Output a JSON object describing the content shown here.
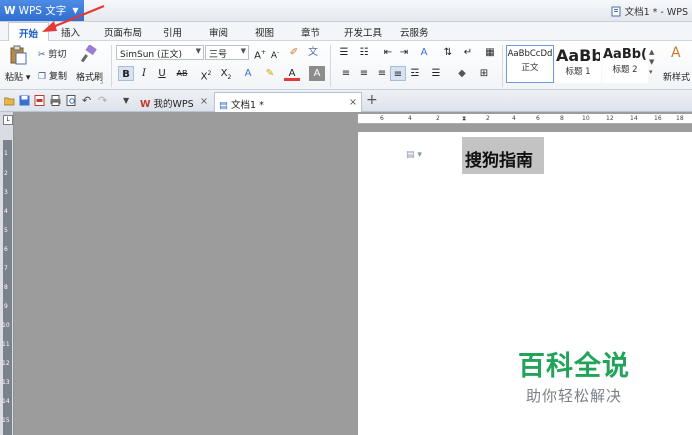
{
  "titlebar": {
    "app_name": "WPS 文字",
    "doc_title": "文档1 * - WPS"
  },
  "menu": {
    "tabs": [
      "开始",
      "插入",
      "页面布局",
      "引用",
      "审阅",
      "视图",
      "章节",
      "开发工具",
      "云服务"
    ],
    "active_index": 0
  },
  "ribbon": {
    "paste_label": "粘贴",
    "cut_label": "剪切",
    "copy_label": "复制",
    "format_painter_label": "格式刷",
    "font_name": "SimSun (正文)",
    "font_size": "三号",
    "styles": [
      {
        "sample": "AaBbCcDd",
        "label": "正文"
      },
      {
        "sample": "AaBb",
        "label": "标题 1"
      },
      {
        "sample": "AaBb(",
        "label": "标题 2"
      }
    ],
    "new_style_label": "新样式"
  },
  "doc_tabs": [
    {
      "label": "我的WPS",
      "active": false
    },
    {
      "label": "文档1 *",
      "active": true
    }
  ],
  "ruler": {
    "vertical_numbers": [
      "1",
      "2",
      "3",
      "4",
      "5",
      "6",
      "7",
      "8",
      "9",
      "10",
      "11",
      "12",
      "13",
      "14",
      "15"
    ],
    "horizontal_numbers": [
      "6",
      "4",
      "2",
      "2",
      "4",
      "6",
      "8",
      "10",
      "12",
      "14",
      "16",
      "18"
    ]
  },
  "document": {
    "heading": "搜狗指南"
  },
  "watermark": {
    "main": "百科全说",
    "sub": "助你轻松解决"
  },
  "colors": {
    "accent": "#2e6ed1",
    "watermark_green": "#22a35a",
    "arrow_red": "#e53935"
  }
}
